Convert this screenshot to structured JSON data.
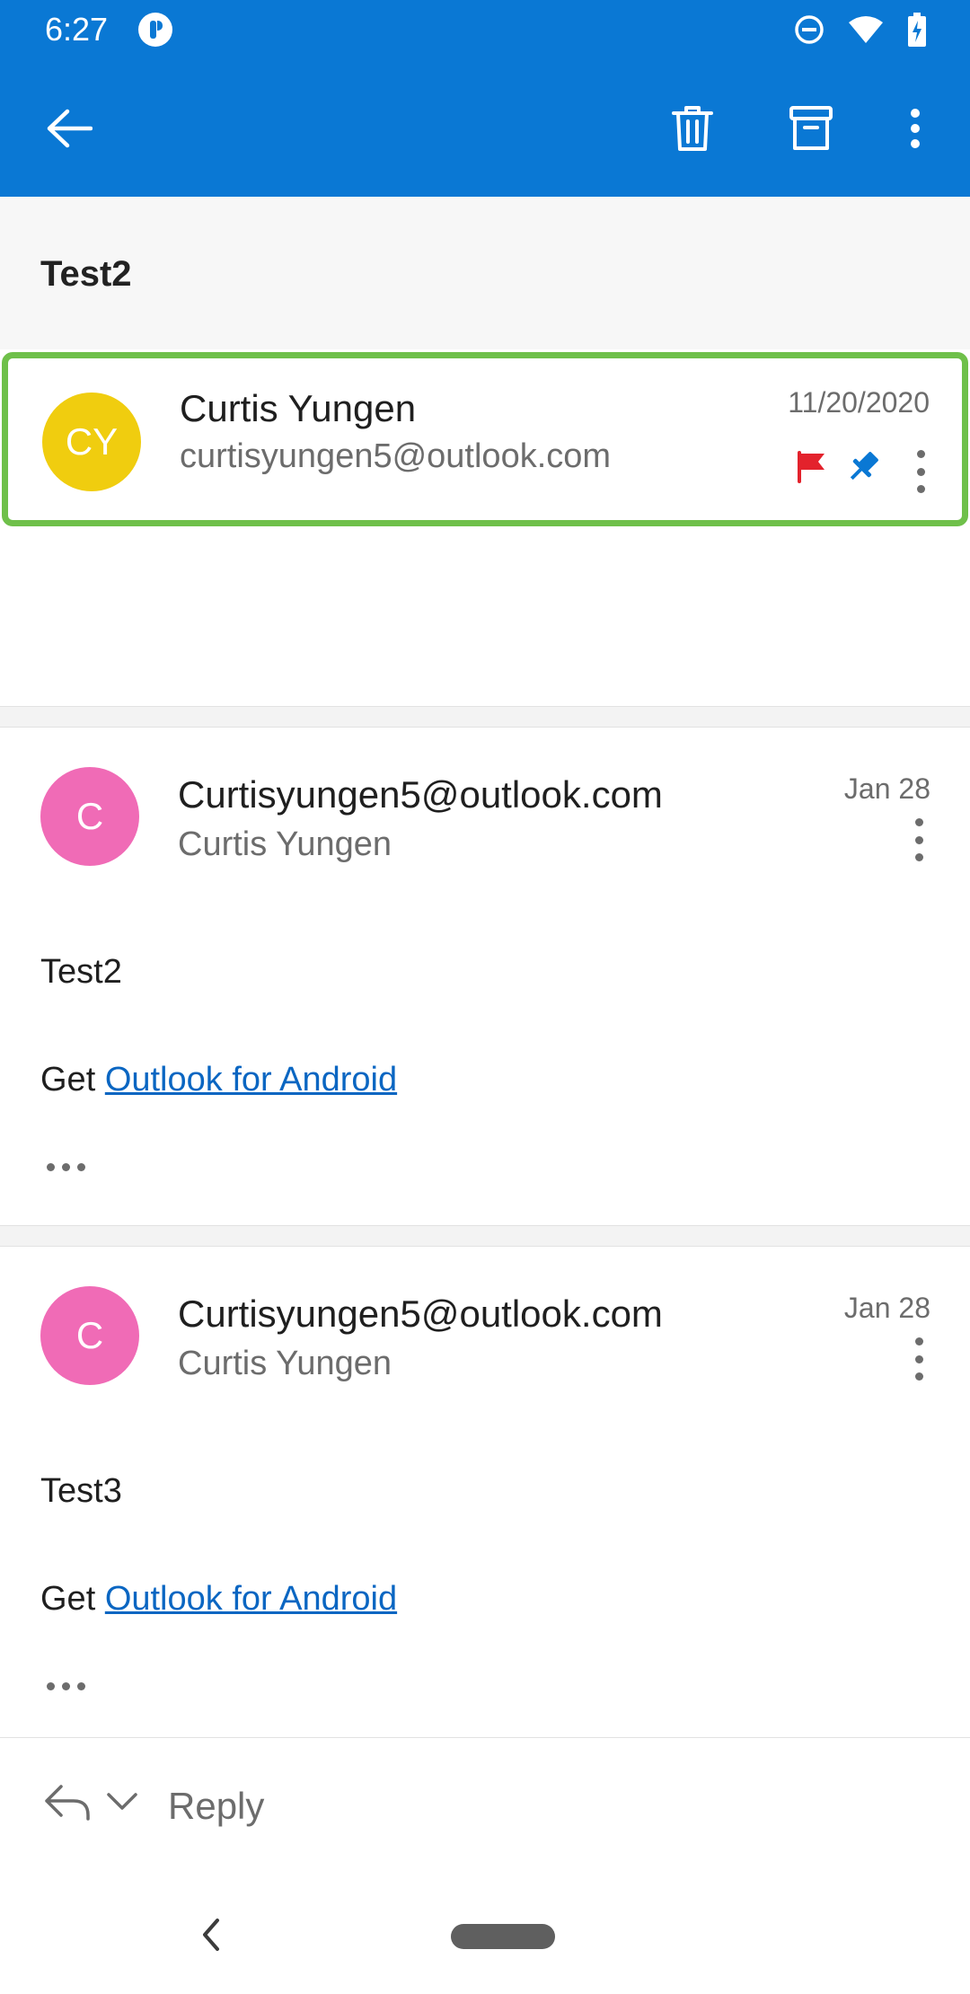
{
  "status_bar": {
    "time": "6:27",
    "icons": [
      "app-notification-icon",
      "do-not-disturb-icon",
      "wifi-icon",
      "battery-charging-icon"
    ]
  },
  "app_bar": {
    "color": "#0a78d4",
    "actions": [
      "back-arrow-icon",
      "trash-icon",
      "archive-icon",
      "more-vert-icon"
    ]
  },
  "thread": {
    "subject": "Test2",
    "highlight_color": "#6fc04a",
    "messages": [
      {
        "avatar_initials": "CY",
        "avatar_color": "#f0cd0f",
        "sender_name": "Curtis Yungen",
        "sender_sub": "curtisyungen5@outlook.com",
        "date": "11/20/2020",
        "flagged": true,
        "pinned": true,
        "flag_color": "#e3222c",
        "pin_color": "#0a78d4"
      },
      {
        "avatar_initials": "C",
        "avatar_color": "#f06bb6",
        "sender_name": "Curtisyungen5@outlook.com",
        "sender_sub": "Curtis Yungen",
        "date": "Jan 28",
        "body_text": "Test2",
        "signature_prefix": "Get",
        "signature_link": "Outlook for Android"
      },
      {
        "avatar_initials": "C",
        "avatar_color": "#f06bb6",
        "sender_name": "Curtisyungen5@outlook.com",
        "sender_sub": "Curtis Yungen",
        "date": "Jan 28",
        "body_text": "Test3",
        "signature_prefix": "Get",
        "signature_link": "Outlook for Android"
      }
    ]
  },
  "reply_bar": {
    "label": "Reply"
  }
}
